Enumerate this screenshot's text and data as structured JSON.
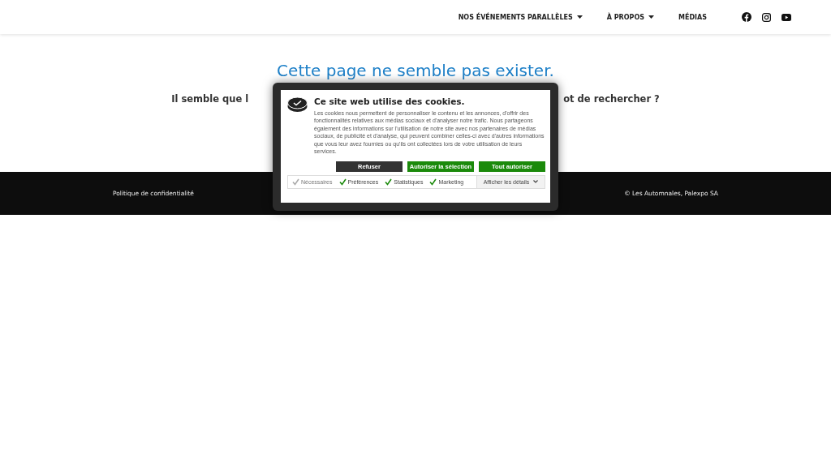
{
  "header": {
    "nav": [
      {
        "label": "NOS ÉVÉNEMENTS PARALLÈLES",
        "dropdown": true
      },
      {
        "label": "À PROPOS",
        "dropdown": true
      },
      {
        "label": "MÉDIAS",
        "dropdown": false
      }
    ],
    "social": [
      {
        "kind": "facebook"
      },
      {
        "kind": "instagram"
      },
      {
        "kind": "youtube"
      }
    ]
  },
  "main": {
    "title": "Cette page ne semble pas exister.",
    "message_parts": [
      "Il semble que l",
      "ot de rechercher ?"
    ]
  },
  "footer": {
    "left": "Politique de confidentialité",
    "right": "© Les Automnales, Palexpo SA"
  },
  "cookie_dialog": {
    "title": "Ce site web utilise des cookies.",
    "text": "Les cookies nous permettent de personnaliser le contenu et les annonces, d'offrir des fonctionnalités relatives aux médias sociaux et d'analyser notre trafic. Nous partageons également des informations sur l'utilisation de notre site avec nos partenaires de médias sociaux, de publicité et d'analyse, qui peuvent combiner celles-ci avec d'autres informations que vous leur avez fournies ou qu'ils ont collectées lors de votre utilisation de leurs services.",
    "buttons": [
      {
        "label": "Refuser",
        "kind": "dark"
      },
      {
        "label": "Autoriser la sélection",
        "kind": "green"
      },
      {
        "label": "Tout autoriser",
        "kind": "green"
      }
    ],
    "consents": [
      {
        "label": "Nécessaires",
        "checked": true,
        "disabled": true
      },
      {
        "label": "Préférences",
        "checked": true,
        "disabled": false
      },
      {
        "label": "Statistiques",
        "checked": true,
        "disabled": false
      },
      {
        "label": "Marketing",
        "checked": true,
        "disabled": false
      }
    ],
    "details": {
      "label": "Afficher les détails"
    }
  }
}
